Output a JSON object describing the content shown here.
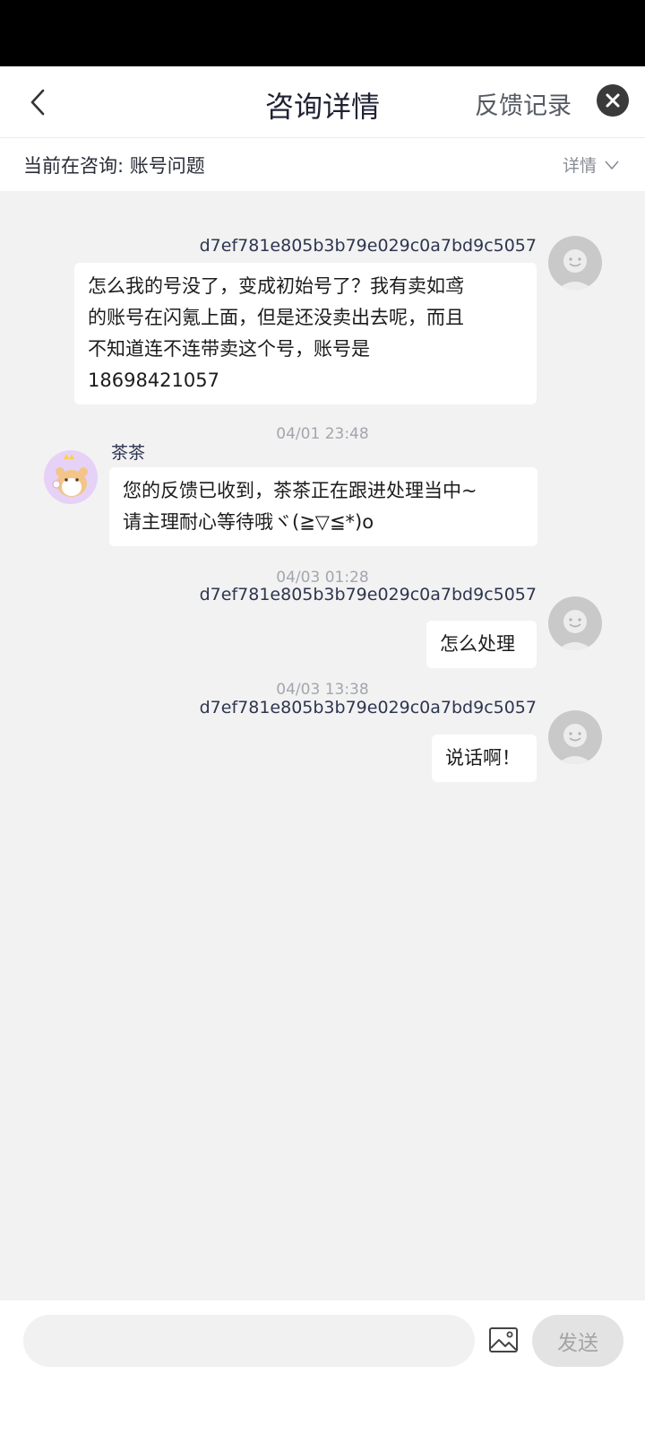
{
  "header": {
    "title": "咨询详情",
    "feedback_link": "反馈记录",
    "back_icon": "chevron-left-icon",
    "close_icon": "close-icon"
  },
  "topic": {
    "text": "当前在咨询: 账号问题",
    "details_label": "详情",
    "details_icon": "chevron-down-icon"
  },
  "messages": [
    {
      "from": "user",
      "name": "d7ef781e805b3b79e029c0a7bd9c5057",
      "lines": [
        "怎么我的号没了，变成初始号了？我有卖如鸢",
        "的账号在闪氪上面，但是还没卖出去呢，而且",
        "不知道连不连带卖这个号，账号是",
        "18698421057"
      ]
    },
    {
      "timestamp": "04/01 23:48",
      "from": "agent",
      "name": "茶茶",
      "lines": [
        "您的反馈已收到，茶茶正在跟进处理当中~",
        "请主理耐心等待哦ヾ(≧▽≦*)o"
      ]
    },
    {
      "timestamp": "04/03 01:28",
      "from": "user",
      "name": "d7ef781e805b3b79e029c0a7bd9c5057",
      "lines": [
        "怎么处理"
      ]
    },
    {
      "timestamp": "04/03 13:38",
      "from": "user",
      "name": "d7ef781e805b3b79e029c0a7bd9c5057",
      "lines": [
        "说话啊！"
      ]
    }
  ],
  "composer": {
    "placeholder": "",
    "image_icon": "image-icon",
    "send_label": "发送"
  },
  "colors": {
    "chat_background": "#f2f2f2",
    "bubble": "#ffffff",
    "send_button_disabled": "#e3e3e3"
  }
}
